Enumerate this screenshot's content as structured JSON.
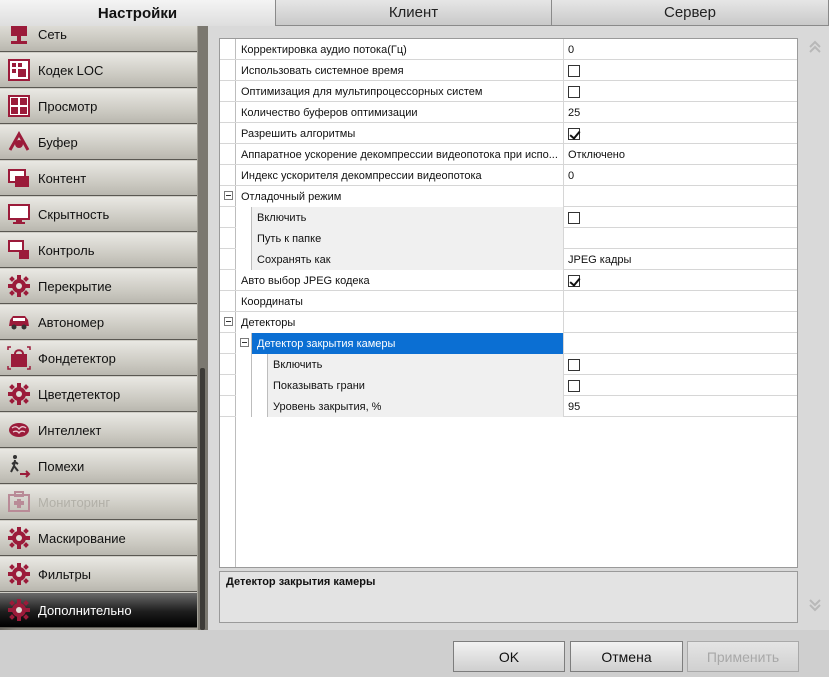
{
  "tabs": [
    {
      "label": "Настройки",
      "active": true
    },
    {
      "label": "Клиент",
      "active": false
    },
    {
      "label": "Сервер",
      "active": false
    }
  ],
  "sidebar": {
    "items": [
      {
        "label": "Сеть",
        "icon": "network-icon"
      },
      {
        "label": "Кодек LOC",
        "icon": "codec-icon"
      },
      {
        "label": "Просмотр",
        "icon": "view-icon"
      },
      {
        "label": "Буфер",
        "icon": "buffer-icon"
      },
      {
        "label": "Контент",
        "icon": "content-icon"
      },
      {
        "label": "Скрытность",
        "icon": "monitor-icon"
      },
      {
        "label": "Контроль",
        "icon": "control-icon"
      },
      {
        "label": "Перекрытие",
        "icon": "gear-icon"
      },
      {
        "label": "Автономер",
        "icon": "car-icon"
      },
      {
        "label": "Фондетектор",
        "icon": "bag-icon"
      },
      {
        "label": "Цветдетектор",
        "icon": "gear-icon"
      },
      {
        "label": "Интеллект",
        "icon": "brain-icon"
      },
      {
        "label": "Помехи",
        "icon": "walker-icon"
      },
      {
        "label": "Мониторинг",
        "icon": "medkit-icon",
        "disabled": true
      },
      {
        "label": "Маскирование",
        "icon": "gear-icon"
      },
      {
        "label": "Фильтры",
        "icon": "gear-icon"
      },
      {
        "label": "Дополнительно",
        "icon": "gear-icon",
        "active": true
      }
    ]
  },
  "grid": {
    "rows": [
      {
        "name": "Корректировка аудио потока(Гц)",
        "value": "0",
        "level": 0
      },
      {
        "name": "Использовать системное время",
        "checkbox": false,
        "level": 0
      },
      {
        "name": "Оптимизация для мультипроцессорных систем",
        "checkbox": false,
        "level": 0
      },
      {
        "name": "Количество буферов оптимизации",
        "value": "25",
        "level": 0
      },
      {
        "name": "Разрешить алгоритмы",
        "checkbox": true,
        "level": 0
      },
      {
        "name": "Аппаратное ускорение декомпрессии видеопотока при испо...",
        "value": "Отключено",
        "level": 0
      },
      {
        "name": "Индекс ускорителя декомпрессии видеопотока",
        "value": "0",
        "level": 0
      },
      {
        "name": "Отладочный режим",
        "group": true,
        "level": 0
      },
      {
        "name": "Включить",
        "checkbox": false,
        "level": 1
      },
      {
        "name": "Путь к папке",
        "value": "",
        "level": 1
      },
      {
        "name": "Сохранять как",
        "value": "JPEG кадры",
        "level": 1
      },
      {
        "name": "Авто выбор JPEG кодека",
        "checkbox": true,
        "level": 0
      },
      {
        "name": "Координаты",
        "value": "",
        "level": 0
      },
      {
        "name": "Детекторы",
        "group": true,
        "level": 0
      },
      {
        "name": "Детектор закрытия камеры",
        "group": true,
        "selected": true,
        "level": 1
      },
      {
        "name": "Включить",
        "checkbox": false,
        "level": 2
      },
      {
        "name": "Показывать грани",
        "checkbox": false,
        "level": 2
      },
      {
        "name": "Уровень закрытия, %",
        "value": "95",
        "level": 2
      }
    ]
  },
  "description": "Детектор закрытия камеры",
  "buttons": {
    "ok": "OK",
    "cancel": "Отмена",
    "apply": "Применить"
  }
}
